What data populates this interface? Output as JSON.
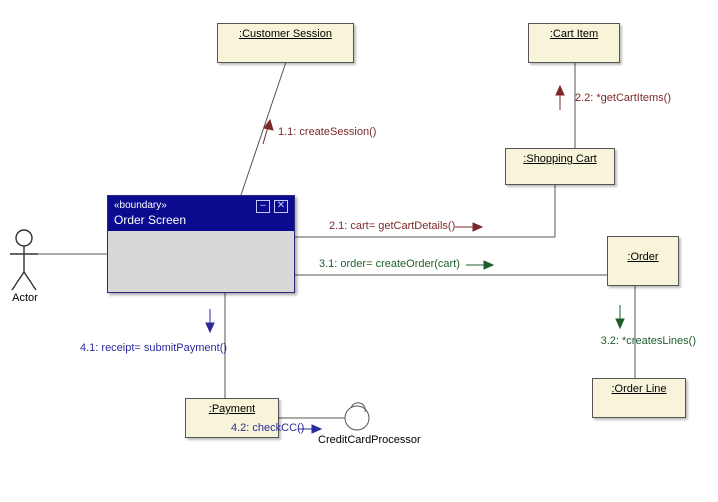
{
  "actor": {
    "label": "Actor"
  },
  "objects": {
    "customer_session": {
      "name": ":Customer Session"
    },
    "cart_item": {
      "name": ":Cart Item"
    },
    "shopping_cart": {
      "name": ":Shopping Cart"
    },
    "order": {
      "name": ":Order"
    },
    "order_line": {
      "name": ":Order Line"
    },
    "payment": {
      "name": ":Payment"
    }
  },
  "boundary": {
    "stereotype": "«boundary»",
    "name": "Order Screen"
  },
  "interface": {
    "name": "CreditCardProcessor"
  },
  "messages": {
    "m11": "1.1:  createSession()",
    "m21": "2.1:  cart= getCartDetails()",
    "m22": "2.2:  *getCartItems()",
    "m31": "3.1:  order= createOrder(cart)",
    "m32": "3.2:  *createsLines()",
    "m41": "4.1:  receipt= submitPayment()",
    "m42": "4.2:  checkCC()"
  },
  "chart_data": {
    "type": "uml-communication-diagram",
    "title": "",
    "lifelines": [
      {
        "id": "actor",
        "name": "Actor",
        "kind": "actor"
      },
      {
        "id": "order_screen",
        "name": "Order Screen",
        "kind": "boundary",
        "stereotype": "«boundary»"
      },
      {
        "id": "customer_session",
        "name": ":Customer Session",
        "kind": "object"
      },
      {
        "id": "shopping_cart",
        "name": ":Shopping Cart",
        "kind": "object"
      },
      {
        "id": "cart_item",
        "name": ":Cart Item",
        "kind": "object"
      },
      {
        "id": "order",
        "name": ":Order",
        "kind": "object"
      },
      {
        "id": "order_line",
        "name": ":Order Line",
        "kind": "object"
      },
      {
        "id": "payment",
        "name": ":Payment",
        "kind": "object"
      },
      {
        "id": "cc_processor",
        "name": "CreditCardProcessor",
        "kind": "interface"
      }
    ],
    "links": [
      {
        "from": "actor",
        "to": "order_screen"
      },
      {
        "from": "order_screen",
        "to": "customer_session"
      },
      {
        "from": "order_screen",
        "to": "shopping_cart"
      },
      {
        "from": "shopping_cart",
        "to": "cart_item"
      },
      {
        "from": "order_screen",
        "to": "order"
      },
      {
        "from": "order",
        "to": "order_line"
      },
      {
        "from": "order_screen",
        "to": "payment"
      },
      {
        "from": "payment",
        "to": "cc_processor"
      }
    ],
    "messages": [
      {
        "seq": "1.1",
        "label": "createSession()",
        "from": "order_screen",
        "to": "customer_session",
        "color": "maroon"
      },
      {
        "seq": "2.1",
        "label": "cart= getCartDetails()",
        "from": "order_screen",
        "to": "shopping_cart",
        "color": "maroon"
      },
      {
        "seq": "2.2",
        "label": "*getCartItems()",
        "from": "shopping_cart",
        "to": "cart_item",
        "color": "maroon"
      },
      {
        "seq": "3.1",
        "label": "order= createOrder(cart)",
        "from": "order_screen",
        "to": "order",
        "color": "green"
      },
      {
        "seq": "3.2",
        "label": "*createsLines()",
        "from": "order",
        "to": "order_line",
        "color": "green"
      },
      {
        "seq": "4.1",
        "label": "receipt= submitPayment()",
        "from": "order_screen",
        "to": "payment",
        "color": "navy"
      },
      {
        "seq": "4.2",
        "label": "checkCC()",
        "from": "payment",
        "to": "cc_processor",
        "color": "navy"
      }
    ]
  }
}
